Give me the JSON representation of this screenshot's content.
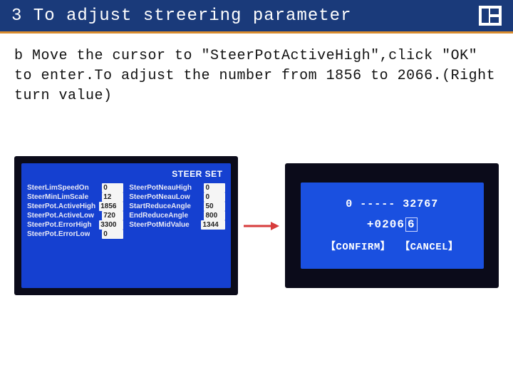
{
  "title": "3 To adjust streering parameter",
  "instruction": "b Move the cursor to  \"SteerPotActiveHigh\",click \"OK\" to enter.To adjust the number from 1856 to 2066.(Right turn value)",
  "screenA": {
    "heading": "STEER SET",
    "left": [
      {
        "label": "SteerLimSpeedOn",
        "value": "0"
      },
      {
        "label": "SteerMinLimScale",
        "value": "12"
      },
      {
        "label": "SteerPot.ActiveHigh",
        "value": "1856"
      },
      {
        "label": "SteerPot.ActiveLow",
        "value": "720"
      },
      {
        "label": "SteerPot.ErrorHigh",
        "value": "3300"
      },
      {
        "label": "SteerPot.ErrorLow",
        "value": "0"
      }
    ],
    "right": [
      {
        "label": "SteerPotNeauHigh",
        "value": "0"
      },
      {
        "label": "SteerPotNeauLow",
        "value": "0"
      },
      {
        "label": "StartReduceAngle",
        "value": "50"
      },
      {
        "label": "EndReduceAngle",
        "value": "800"
      },
      {
        "label": "SteerPotMidValue",
        "value": "1344"
      }
    ]
  },
  "screenB": {
    "range": "0 ----- 32767",
    "valuePrefix": "+0206",
    "valueEditDigit": "6",
    "confirm": "【CONFIRM】",
    "cancel": "【CANCEL】"
  }
}
